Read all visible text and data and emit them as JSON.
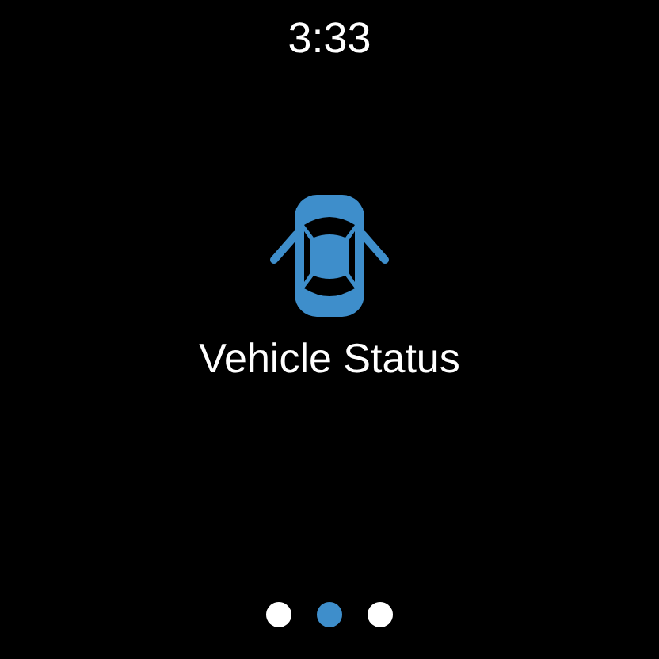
{
  "time": "3:33",
  "app": {
    "label": "Vehicle Status"
  },
  "pages": [
    {
      "selected": false
    },
    {
      "selected": true
    },
    {
      "selected": false
    }
  ]
}
